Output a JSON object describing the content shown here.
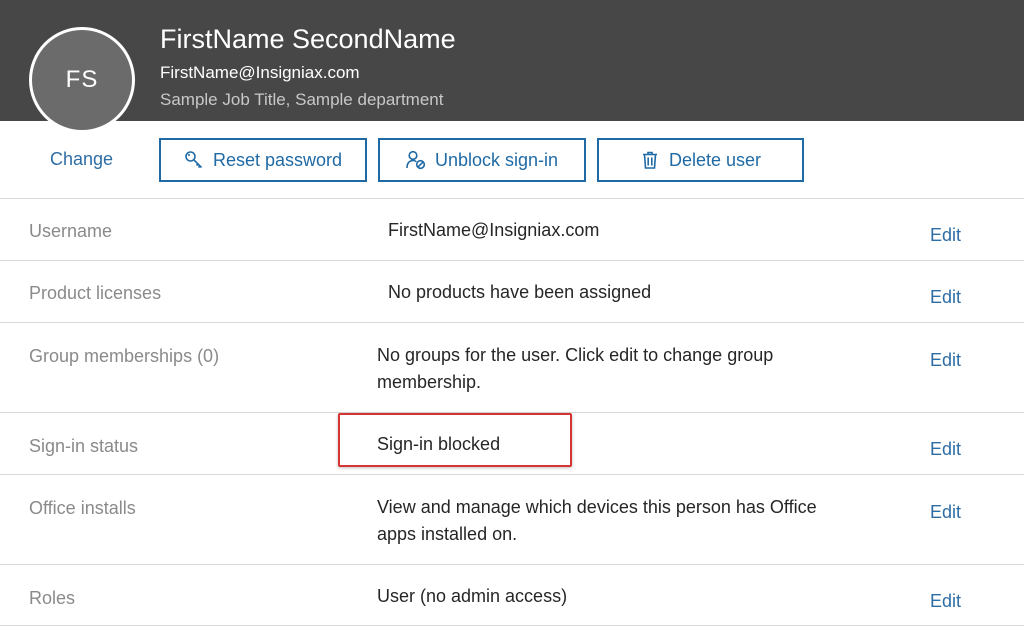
{
  "profile": {
    "initials": "FS",
    "name": "FirstName SecondName",
    "email": "FirstName@Insigniax.com",
    "job_title": "Sample Job Title, Sample department"
  },
  "actions": {
    "change_label": "Change",
    "reset_password_label": "Reset password",
    "unblock_signin_label": "Unblock sign-in",
    "delete_user_label": "Delete user"
  },
  "details": {
    "edit_label": "Edit",
    "rows": [
      {
        "label": "Username",
        "value": "FirstName@Insigniax.com"
      },
      {
        "label": "Product licenses",
        "value": "No products have been assigned"
      },
      {
        "label": "Group memberships (0)",
        "value": "No groups for the user. Click edit to change group membership."
      },
      {
        "label": "Sign-in status",
        "value": "Sign-in blocked"
      },
      {
        "label": "Office installs",
        "value": "View and manage which devices this person has Office apps installed on."
      },
      {
        "label": "Roles",
        "value": "User (no admin access)"
      }
    ]
  },
  "colors": {
    "header_bg": "#474747",
    "accent": "#1f6aa5",
    "highlight": "#d43434"
  },
  "icons": [
    "key-icon",
    "person-unblock-icon",
    "trash-icon"
  ]
}
